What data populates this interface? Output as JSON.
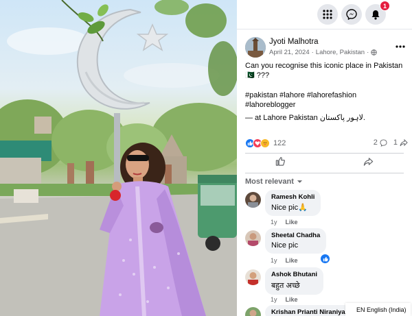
{
  "nav": {
    "notifications_count": "1"
  },
  "post": {
    "author": "Jyoti Malhotra",
    "date": "April 21, 2024",
    "location_meta": "Lahore, Pakistan",
    "separator": "·",
    "caption": "Can you recognise this iconic place in Pakistan 🇵🇰 ???",
    "hashtags": "#pakistan #lahore #lahorefashion #lahoreblogger",
    "checkin_prefix": "— at ",
    "checkin_place": "Lahore Pakistan لاہور پاکستان",
    "checkin_suffix": ".",
    "reaction_count": "122",
    "comment_count": "2",
    "share_count": "1"
  },
  "comments_header": {
    "sort_label": "Most relevant"
  },
  "comments": [
    {
      "name": "Ramesh Kohli",
      "text": "Nice pic🙏",
      "age": "1y",
      "like_label": "Like"
    },
    {
      "name": "Sheetal Chadha",
      "text": "Nice pic",
      "age": "1y",
      "like_label": "Like"
    },
    {
      "name": "Ashok Bhutani",
      "text": "बहुत अच्छे",
      "age": "1y",
      "like_label": "Like"
    },
    {
      "name": "Krishan Prianti Niraniya",
      "text": "",
      "age": "",
      "like_label": ""
    }
  ],
  "footer": {
    "language": "EN English (India)"
  },
  "colors": {
    "like_blue": "#1877f2",
    "love_red": "#f33e58",
    "care_yellow": "#f7b928",
    "badge_red": "#e41e3f",
    "bubble_gray": "#f0f2f5",
    "dress_lilac": "#c9a3e8"
  }
}
